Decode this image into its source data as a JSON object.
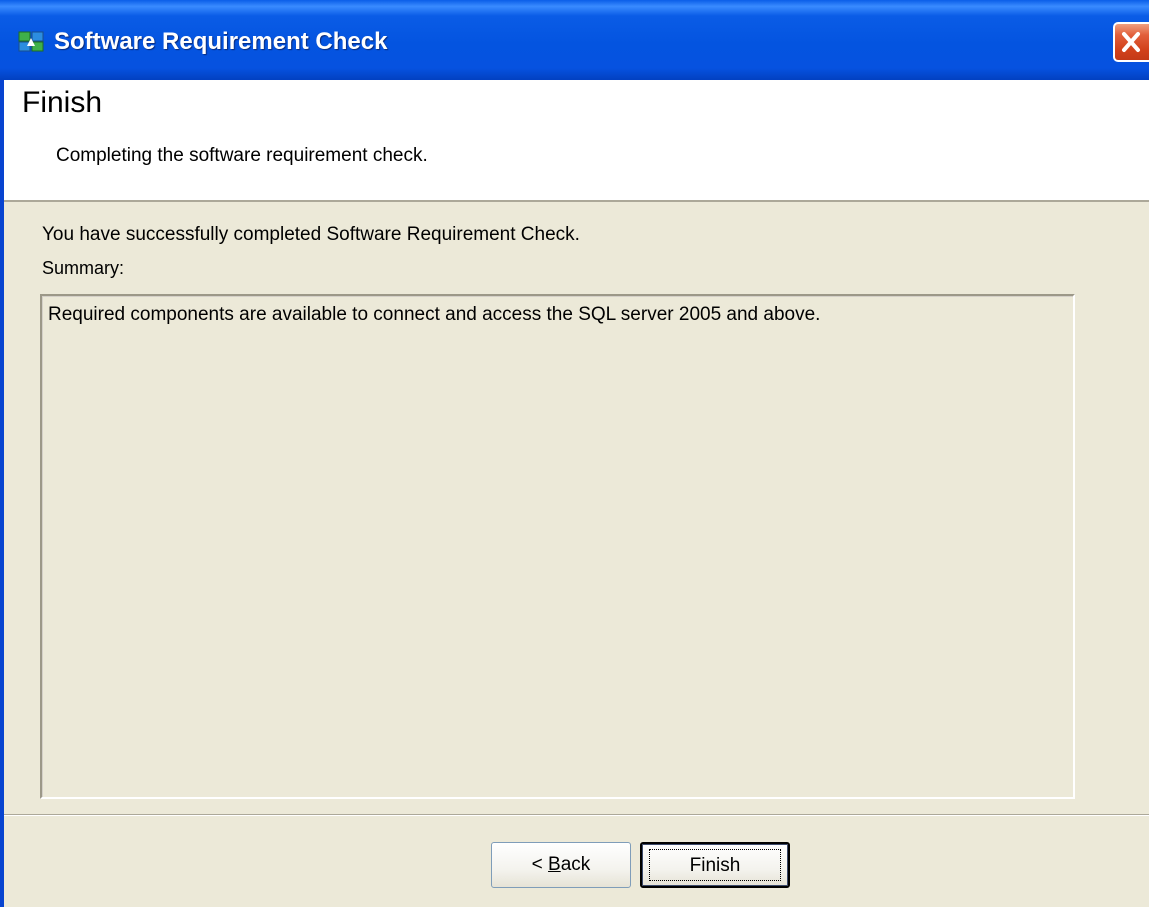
{
  "window": {
    "title": "Software Requirement Check",
    "icon": "app-icon",
    "close_icon": "close-icon"
  },
  "header": {
    "title": "Finish",
    "subtitle": "Completing the software requirement check."
  },
  "body": {
    "success_message": "You have successfully completed Software Requirement Check.",
    "summary_label": "Summary:",
    "summary_text": "Required components are available to connect and access the SQL server 2005 and above."
  },
  "buttons": {
    "back_prefix": "< ",
    "back_mnemonic": "B",
    "back_rest": "ack",
    "finish": "Finish"
  },
  "colors": {
    "titlebar": "#0a5ce6",
    "close": "#d2421c",
    "dialog_bg": "#ece9d8"
  }
}
